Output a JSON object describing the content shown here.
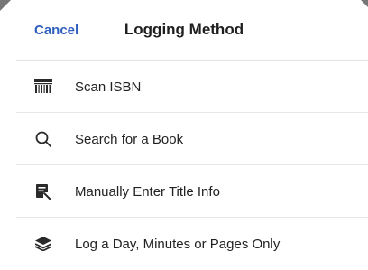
{
  "header": {
    "cancel_label": "Cancel",
    "title": "Logging Method"
  },
  "menu": {
    "items": [
      {
        "label": "Scan ISBN",
        "icon": "barcode-icon"
      },
      {
        "label": "Search for a Book",
        "icon": "search-icon"
      },
      {
        "label": "Manually Enter Title Info",
        "icon": "edit-document-icon"
      },
      {
        "label": "Log a Day, Minutes or Pages Only",
        "icon": "layers-icon"
      }
    ]
  },
  "colors": {
    "accent": "#2f5fbf",
    "text": "#222222",
    "divider": "#e6e6e6"
  }
}
